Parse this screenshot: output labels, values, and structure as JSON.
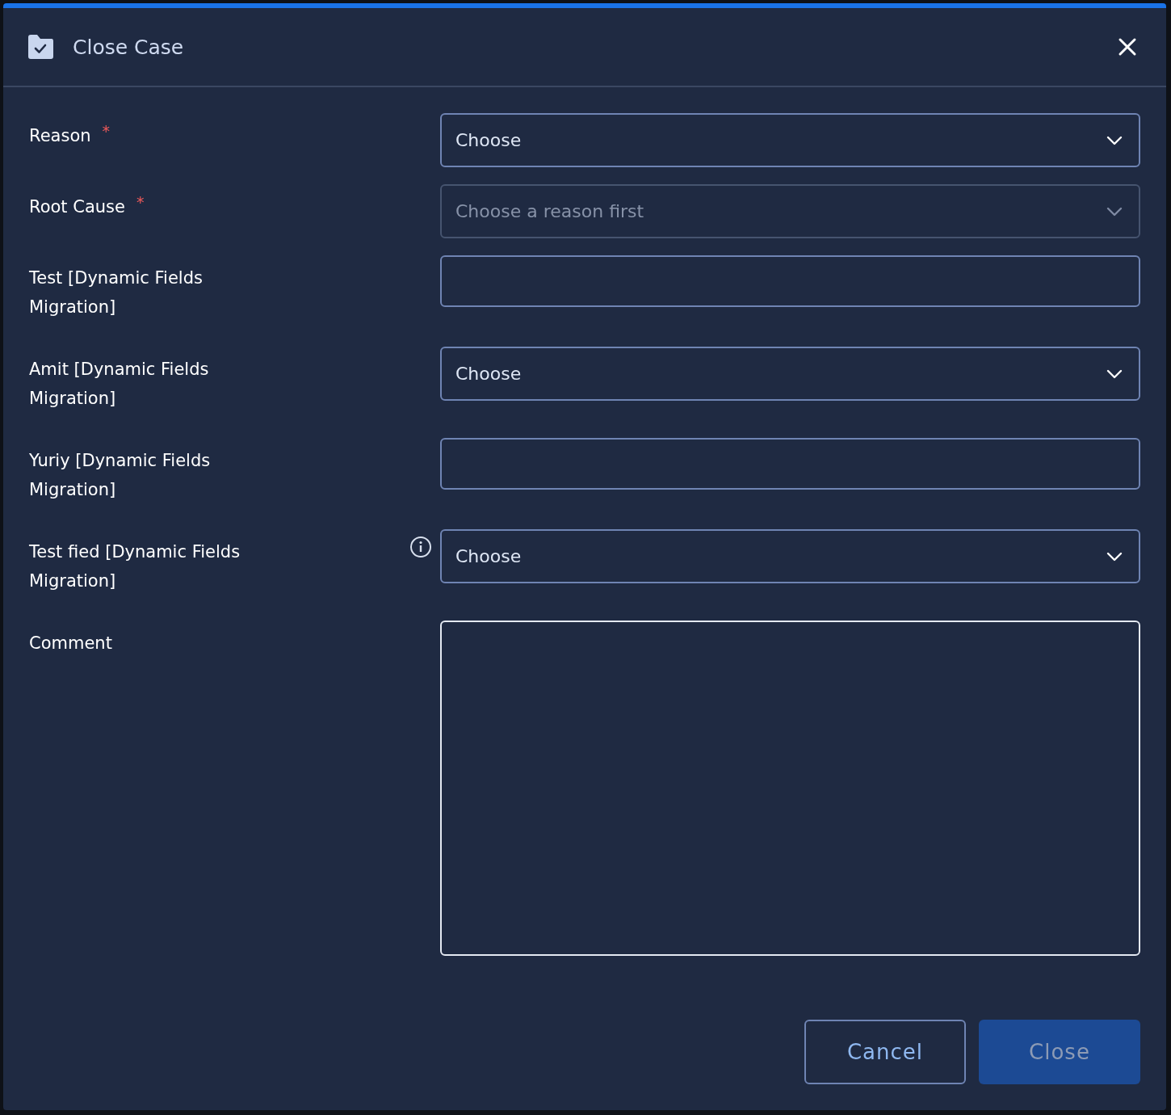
{
  "dialog": {
    "title": "Close Case"
  },
  "fields": [
    {
      "kind": "select",
      "label": "Reason",
      "required_mark": "*",
      "disabled": false,
      "value": "Choose"
    },
    {
      "kind": "select",
      "label": "Root Cause",
      "required_mark": "*",
      "disabled": true,
      "placeholder": "Choose a reason first"
    },
    {
      "kind": "text",
      "label": "Test [Dynamic Fields Migration]"
    },
    {
      "kind": "select",
      "label": "Amit [Dynamic Fields Migration]",
      "disabled": false,
      "value": "Choose"
    },
    {
      "kind": "text",
      "label": "Yuriy [Dynamic Fields Migration]"
    },
    {
      "kind": "select",
      "label": "Test fied [Dynamic Fields Migration]",
      "info": true,
      "disabled": false,
      "value": "Choose"
    },
    {
      "kind": "textarea",
      "label": "Comment"
    }
  ],
  "buttons": [
    {
      "label": "Cancel",
      "kind": "secondary"
    },
    {
      "label": "Close",
      "kind": "primary",
      "disabled": true
    }
  ]
}
